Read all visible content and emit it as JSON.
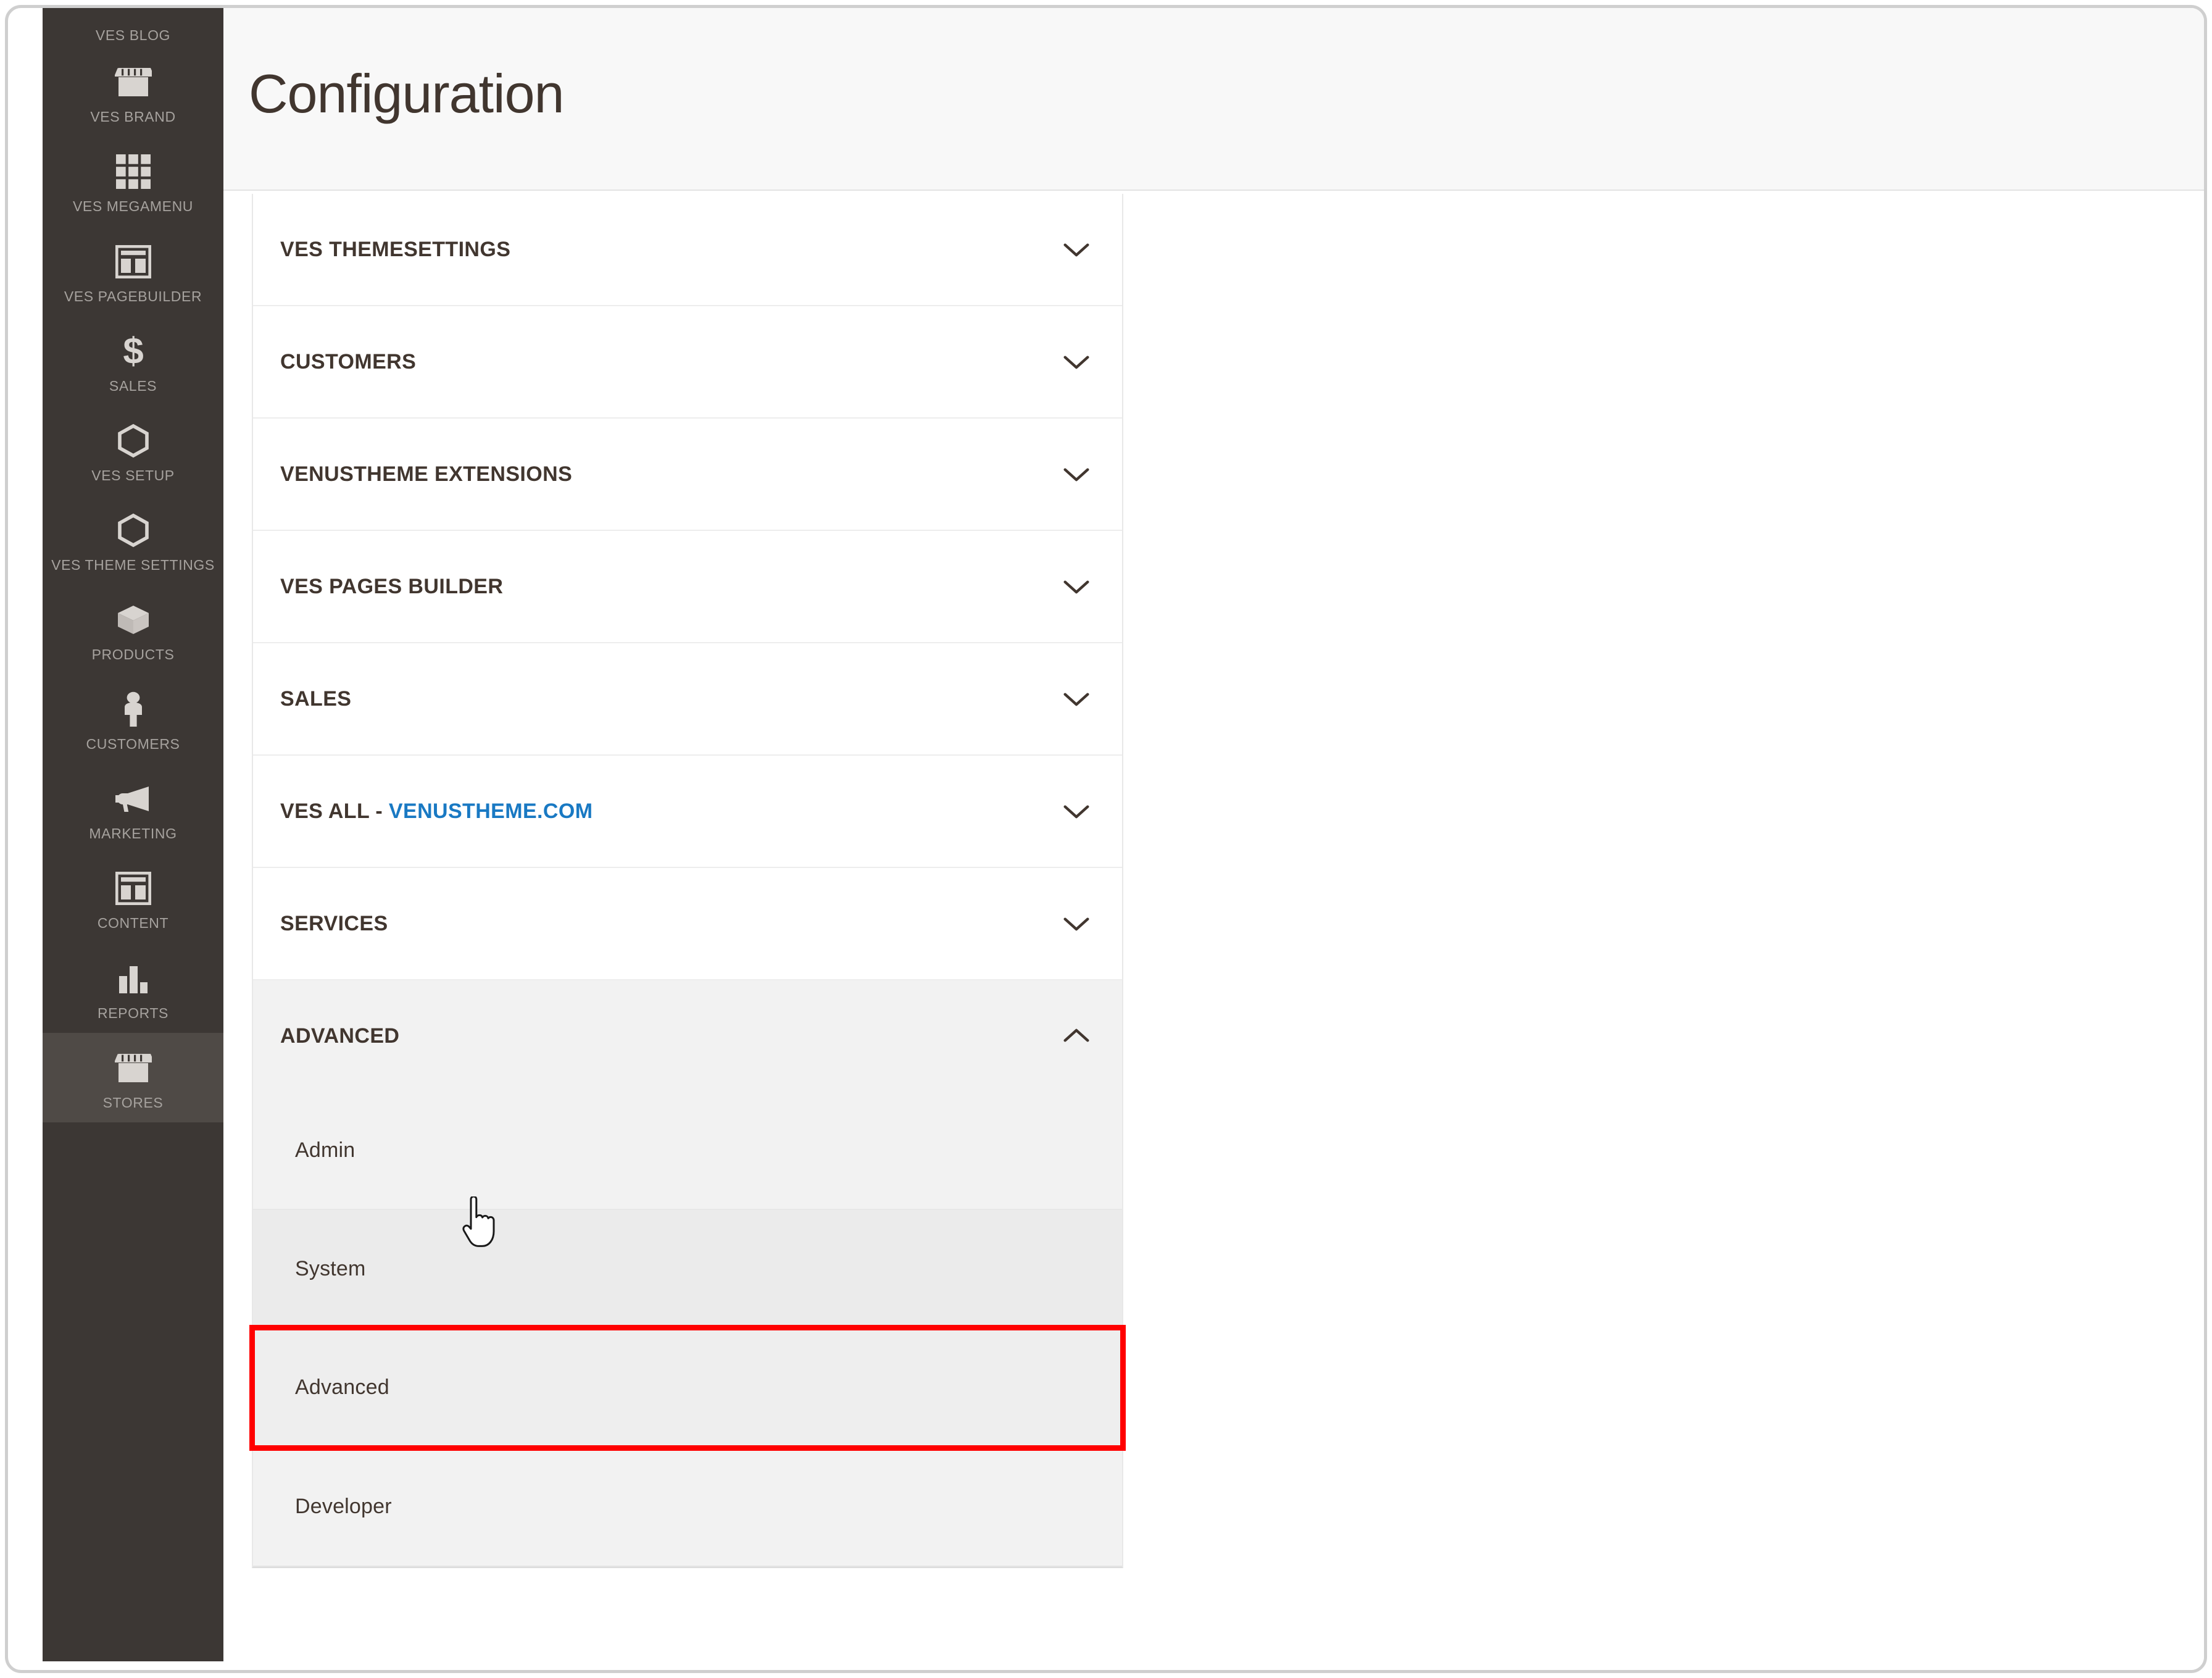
{
  "sidebar": {
    "top_label": "VES BLOG",
    "items": [
      {
        "label": "VES BRAND",
        "icon": "storefront-icon",
        "active": false
      },
      {
        "label": "VES MEGAMENU",
        "icon": "grid-icon",
        "active": false
      },
      {
        "label": "VES PAGEBUILDER",
        "icon": "layout-icon",
        "active": false
      },
      {
        "label": "SALES",
        "icon": "dollar-icon",
        "active": false
      },
      {
        "label": "VES SETUP",
        "icon": "hexagon-icon",
        "active": false
      },
      {
        "label": "VES THEME SETTINGS",
        "icon": "hexagon-icon",
        "active": false
      },
      {
        "label": "PRODUCTS",
        "icon": "box-icon",
        "active": false
      },
      {
        "label": "CUSTOMERS",
        "icon": "person-icon",
        "active": false
      },
      {
        "label": "MARKETING",
        "icon": "megaphone-icon",
        "active": false
      },
      {
        "label": "CONTENT",
        "icon": "layout-icon",
        "active": false
      },
      {
        "label": "REPORTS",
        "icon": "bar-chart-icon",
        "active": false
      },
      {
        "label": "STORES",
        "icon": "storefront-icon",
        "active": true
      }
    ]
  },
  "header": {
    "title": "Configuration"
  },
  "config": {
    "sections": [
      {
        "title": "VES THEMESETTINGS",
        "link_part": "",
        "expanded": false,
        "chevron": "chevron-down-icon"
      },
      {
        "title": "CUSTOMERS",
        "link_part": "",
        "expanded": false,
        "chevron": "chevron-down-icon"
      },
      {
        "title": "VENUSTHEME EXTENSIONS",
        "link_part": "",
        "expanded": false,
        "chevron": "chevron-down-icon"
      },
      {
        "title": "VES PAGES BUILDER",
        "link_part": "",
        "expanded": false,
        "chevron": "chevron-down-icon"
      },
      {
        "title": "SALES",
        "link_part": "",
        "expanded": false,
        "chevron": "chevron-down-icon"
      },
      {
        "title": "VES ALL - ",
        "link_part": "VENUSTHEME.COM",
        "expanded": false,
        "chevron": "chevron-down-icon"
      },
      {
        "title": "SERVICES",
        "link_part": "",
        "expanded": false,
        "chevron": "chevron-down-icon"
      },
      {
        "title": "ADVANCED",
        "link_part": "",
        "expanded": true,
        "chevron": "chevron-up-icon"
      }
    ],
    "advanced_subitems": [
      {
        "label": "Admin",
        "state": "normal"
      },
      {
        "label": "System",
        "state": "hover"
      },
      {
        "label": "Advanced",
        "state": "selected"
      },
      {
        "label": "Developer",
        "state": "normal"
      }
    ]
  },
  "annotation": {
    "highlight_color": "#ff0000",
    "highlight_target": "Advanced"
  },
  "colors": {
    "sidebar_bg": "#3c3734",
    "sidebar_text": "#a6a29e",
    "accent_link": "#1979c3",
    "text_primary": "#41362f",
    "panel_bg": "#ffffff",
    "expanded_bg": "#f2f2f2"
  }
}
